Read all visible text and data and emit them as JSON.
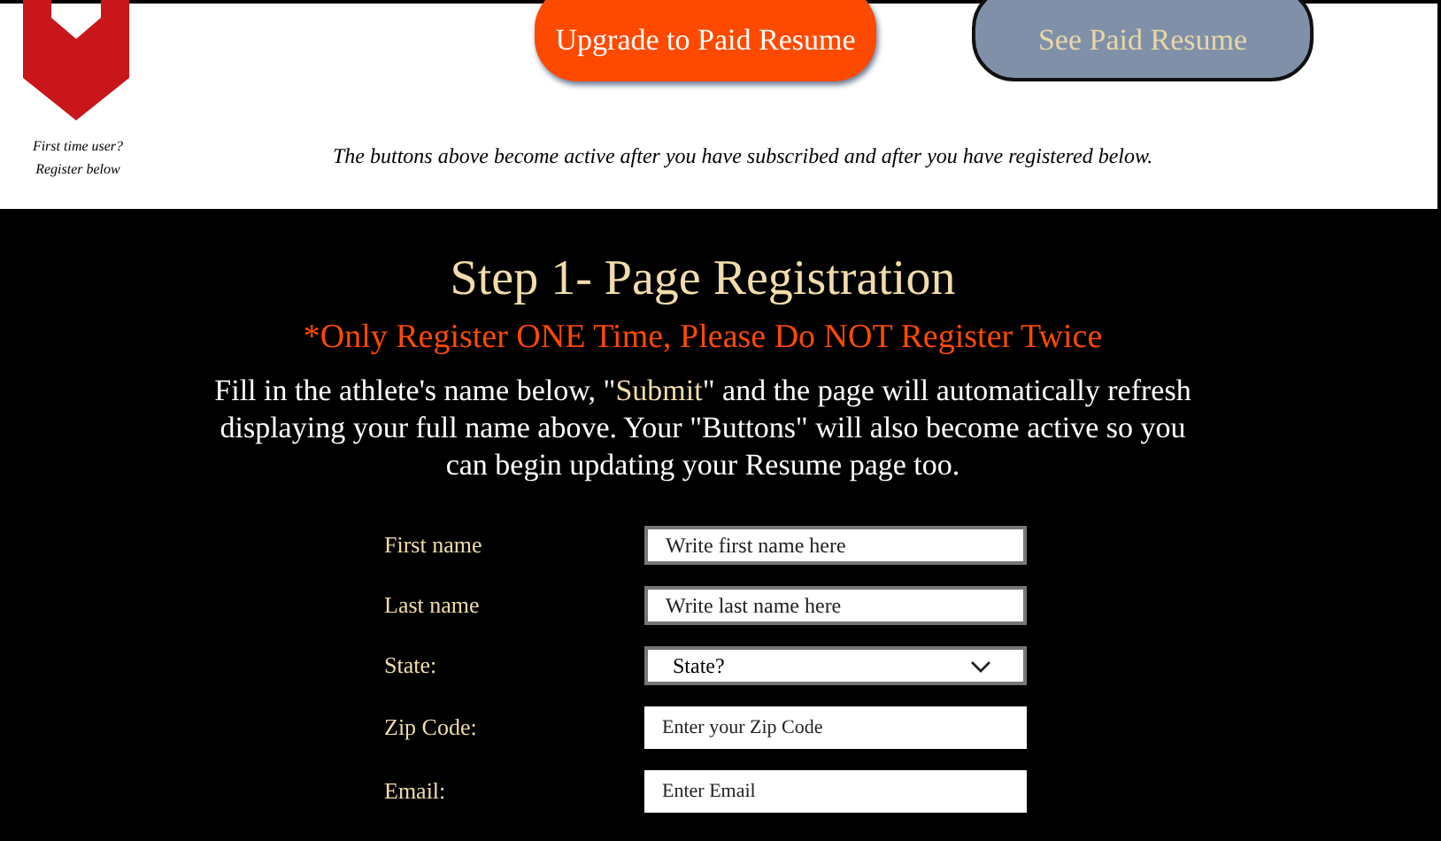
{
  "header": {
    "first_time_note": [
      "First time user?",
      "Register below"
    ],
    "buttons": [
      {
        "label": "Upgrade to Paid Resume",
        "active": true
      },
      {
        "label": "See Paid Resume",
        "active": false
      }
    ],
    "notice": "The buttons above become active after you have subscribed and after you have registered below."
  },
  "registration": {
    "title": "Step 1- Page Registration",
    "warning": "*Only Register ONE Time, Please Do NOT Register Twice",
    "intro": [
      {
        "text": "Fill in the athlete's name below, \"",
        "highlight": false
      },
      {
        "text": "Submit",
        "highlight": true
      },
      {
        "text": "\" and the page will automatically refresh displaying your full name above. Your \"Buttons\" will also become active so you can begin updating your Resume page too.",
        "highlight": false
      }
    ],
    "fields": [
      {
        "label": "First name",
        "kind": "text",
        "placeholder": "Write first name here"
      },
      {
        "label": "Last name",
        "kind": "text",
        "placeholder": "Write last name here"
      },
      {
        "label": "State:",
        "kind": "select",
        "placeholder": "State?"
      },
      {
        "label": "Zip Code:",
        "kind": "plain",
        "placeholder": "Enter your Zip Code"
      },
      {
        "label": "Email:",
        "kind": "plain",
        "placeholder": "Enter Email"
      }
    ]
  }
}
